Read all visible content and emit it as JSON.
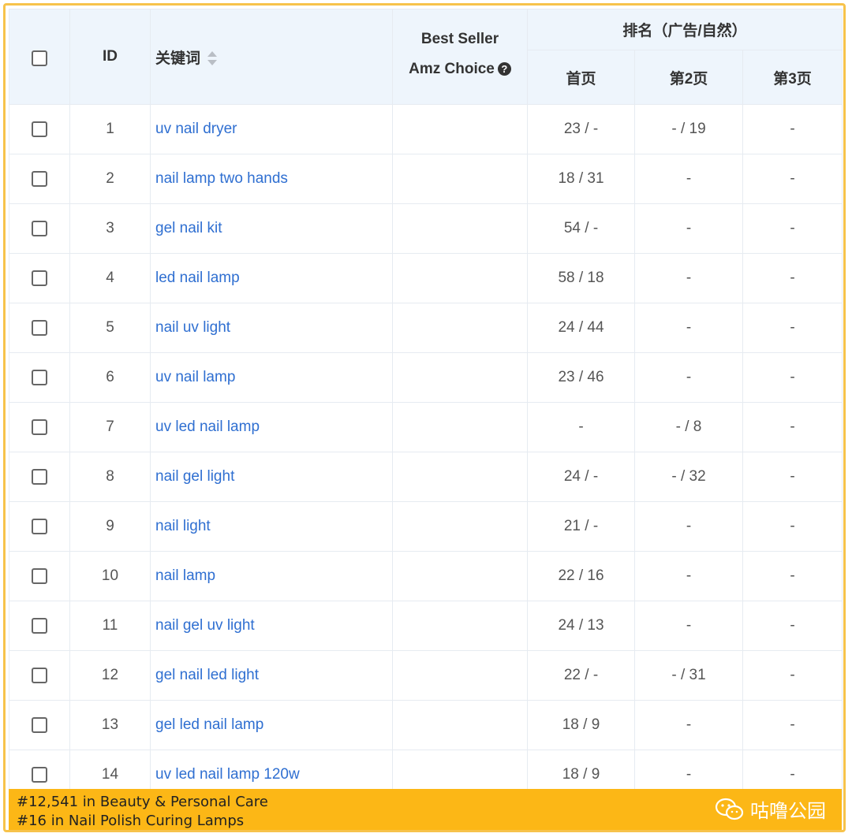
{
  "header": {
    "id": "ID",
    "keyword": "关键词",
    "best_seller": "Best Seller",
    "amz_choice": "Amz Choice",
    "rank_group": "排名（广告/自然）",
    "page1": "首页",
    "page2": "第2页",
    "page3": "第3页"
  },
  "rows": [
    {
      "id": "1",
      "keyword": "uv nail dryer",
      "p1": "23 / -",
      "p2": "- / 19",
      "p3": "-"
    },
    {
      "id": "2",
      "keyword": "nail lamp two hands",
      "p1": "18 / 31",
      "p2": "-",
      "p3": "-"
    },
    {
      "id": "3",
      "keyword": "gel nail kit",
      "p1": "54 / -",
      "p2": "-",
      "p3": "-"
    },
    {
      "id": "4",
      "keyword": "led nail lamp",
      "p1": "58 / 18",
      "p2": "-",
      "p3": "-"
    },
    {
      "id": "5",
      "keyword": "nail uv light",
      "p1": "24 / 44",
      "p2": "-",
      "p3": "-"
    },
    {
      "id": "6",
      "keyword": "uv nail lamp",
      "p1": "23 / 46",
      "p2": "-",
      "p3": "-"
    },
    {
      "id": "7",
      "keyword": "uv led nail lamp",
      "p1": "-",
      "p2": "- / 8",
      "p3": "-"
    },
    {
      "id": "8",
      "keyword": "nail gel light",
      "p1": "24 / -",
      "p2": "- / 32",
      "p3": "-"
    },
    {
      "id": "9",
      "keyword": "nail light",
      "p1": "21 / -",
      "p2": "-",
      "p3": "-"
    },
    {
      "id": "10",
      "keyword": "nail lamp",
      "p1": "22 / 16",
      "p2": "-",
      "p3": "-"
    },
    {
      "id": "11",
      "keyword": "nail gel uv light",
      "p1": "24 / 13",
      "p2": "-",
      "p3": "-"
    },
    {
      "id": "12",
      "keyword": "gel nail led light",
      "p1": "22 / -",
      "p2": "- / 31",
      "p3": "-"
    },
    {
      "id": "13",
      "keyword": "gel led nail lamp",
      "p1": "18 / 9",
      "p2": "-",
      "p3": "-"
    },
    {
      "id": "14",
      "keyword": "uv led nail lamp 120w",
      "p1": "18 / 9",
      "p2": "-",
      "p3": "-"
    }
  ],
  "footer": {
    "line1": "#12,541 in Beauty & Personal Care",
    "line2": "#16 in Nail Polish Curing Lamps",
    "watermark": "咕噜公园"
  },
  "icons": {
    "sort": "sort-icon",
    "help": "help-icon",
    "wechat": "wechat-icon"
  },
  "colors": {
    "header_bg": "#eef5fc",
    "link": "#2f6fd1",
    "footer_bg": "#fcb716",
    "frame_border": "#f7c34b"
  }
}
